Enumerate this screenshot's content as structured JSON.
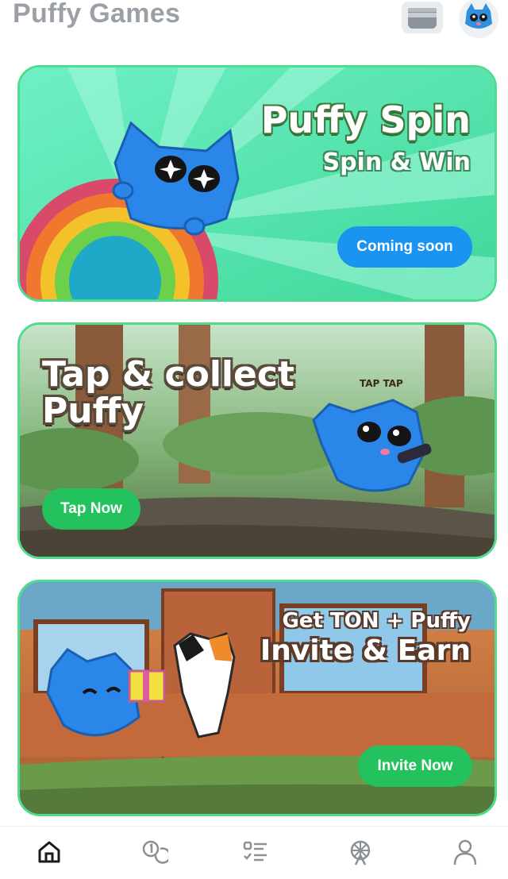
{
  "header": {
    "title": "Puffy Games",
    "wallet_icon": "wallet-icon",
    "avatar_icon": "avatar-cat-icon"
  },
  "cards": [
    {
      "title": "Puffy Spin",
      "subtitle": "Spin & Win",
      "button_label": "Coming soon",
      "button_color": "#1a94f0"
    },
    {
      "title_line1": "Tap & collect",
      "title_line2": "Puffy",
      "button_label": "Tap Now",
      "button_color": "#23c25e",
      "sticker_text": "TAP TAP"
    },
    {
      "subtitle": "Get TON + Puffy",
      "title": "Invite & Earn",
      "button_label": "Invite Now",
      "button_color": "#23c25e"
    }
  ],
  "tabbar": {
    "items": [
      {
        "icon": "home-icon",
        "active": true
      },
      {
        "icon": "coins-icon",
        "active": false
      },
      {
        "icon": "tasks-list-icon",
        "active": false
      },
      {
        "icon": "ferris-wheel-icon",
        "active": false
      },
      {
        "icon": "profile-icon",
        "active": false
      }
    ]
  },
  "colors": {
    "card_border": "#4fdc8f",
    "title_gray": "#9aa0a6"
  }
}
